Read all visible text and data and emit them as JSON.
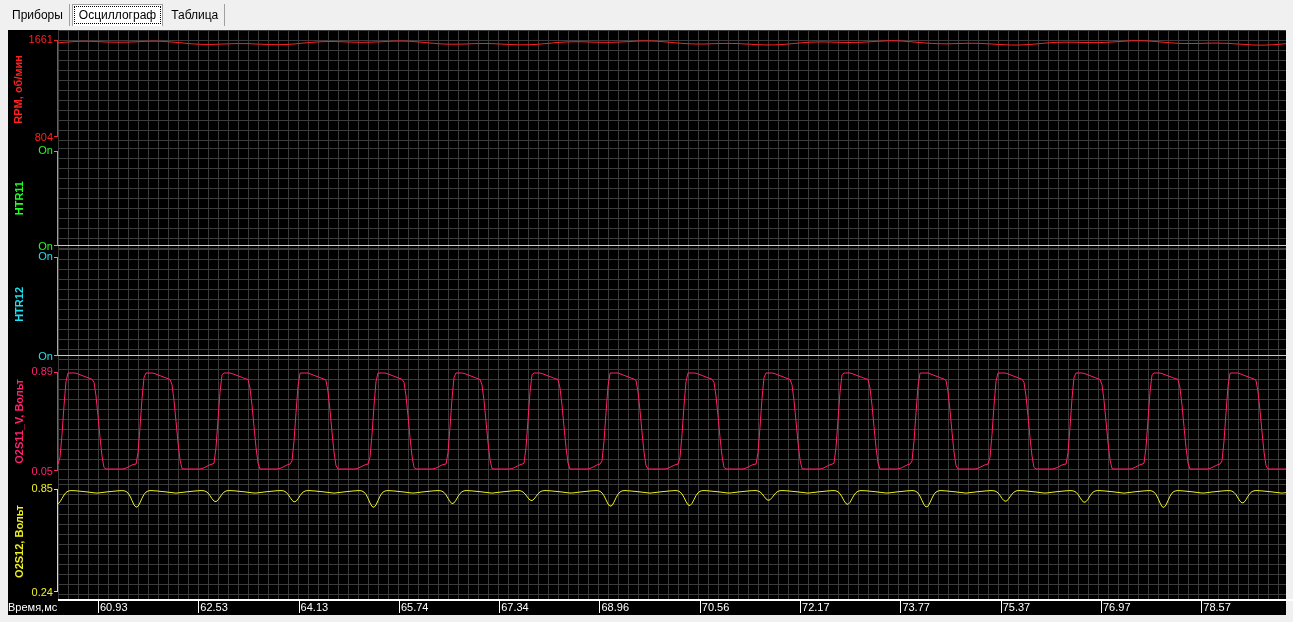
{
  "tabs": [
    {
      "label": "Приборы",
      "selected": false
    },
    {
      "label": "Осциллограф",
      "selected": true
    },
    {
      "label": "Таблица",
      "selected": false
    }
  ],
  "channels": [
    {
      "name": "RPM, об/мин",
      "kind": "steady",
      "color": "#ff2020",
      "max": "1661",
      "min": "804"
    },
    {
      "name": "HTR11",
      "kind": "digital",
      "color": "#20ff20",
      "max": "On",
      "min": "On"
    },
    {
      "name": "HTR12",
      "kind": "digital",
      "color": "#20e0f0",
      "max": "On",
      "min": "On"
    },
    {
      "name": "O2S11_V, Вольт",
      "kind": "pulse",
      "color": "#ff2070",
      "max": "0.89",
      "min": "0.05"
    },
    {
      "name": "O2S12, Вольт",
      "kind": "ripple",
      "color": "#f0f020",
      "max": "0.85",
      "min": "0.24"
    }
  ],
  "time_axis": {
    "label": "Время,мс",
    "ticks": [
      "60.93",
      "62.53",
      "64.13",
      "65.74",
      "67.34",
      "68.96",
      "70.56",
      "72.17",
      "73.77",
      "75.37",
      "76.97",
      "78.57"
    ]
  }
}
